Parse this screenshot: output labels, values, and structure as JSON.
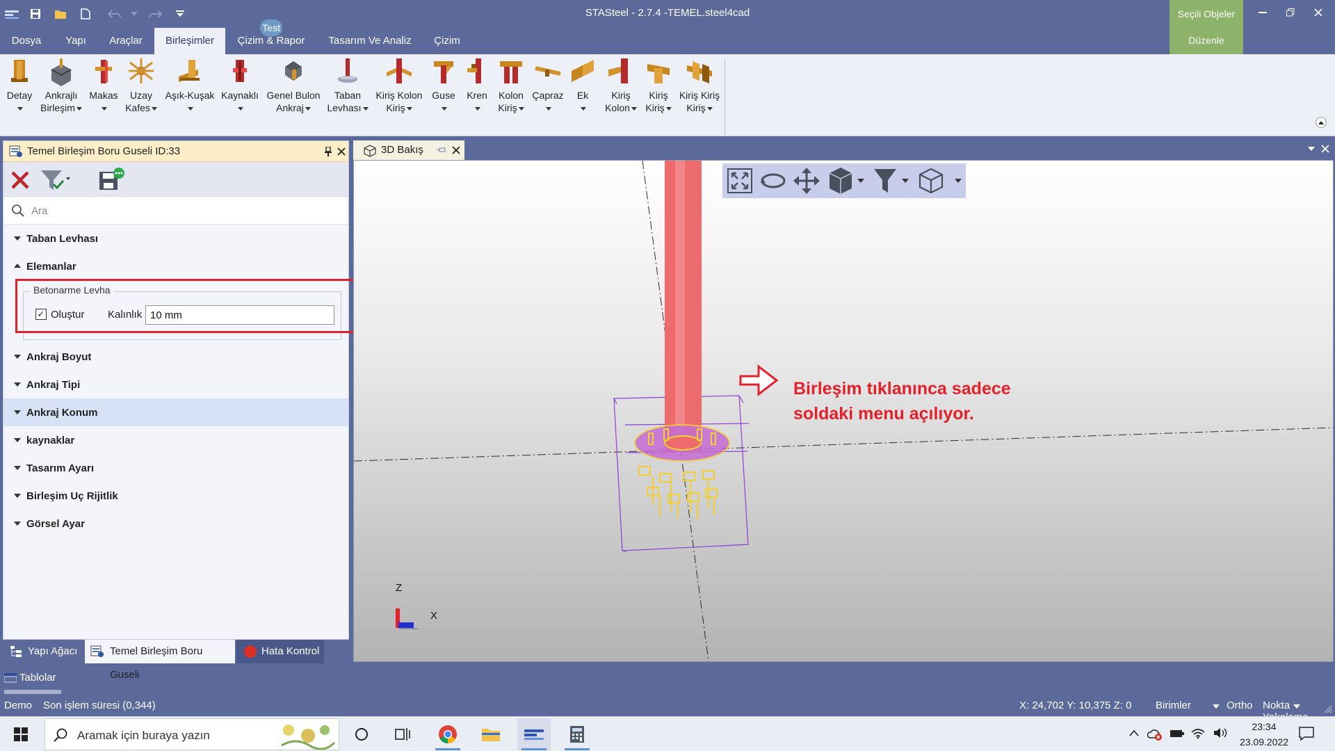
{
  "titlebar": {
    "app_title": "STASteel - 2.7.4 -TEMEL.steel4cad"
  },
  "menu": {
    "tabs": [
      "Dosya",
      "Yapı",
      "Araçlar",
      "Birleşimler",
      "Çizim & Rapor",
      "Tasarım Ve Analiz",
      "Çizim"
    ],
    "active": "Birleşimler",
    "test_badge": "Test"
  },
  "selected_objects": {
    "title": "Seçili Objeler",
    "edit": "Düzenle"
  },
  "ribbon": {
    "buttons": [
      {
        "l1": "Detay",
        "l2": "",
        "dd": true
      },
      {
        "l1": "Ankrajlı",
        "l2": "Birleşim",
        "dd": true
      },
      {
        "l1": "Makas",
        "l2": "",
        "dd": true
      },
      {
        "l1": "Uzay",
        "l2": "Kafes",
        "dd": true
      },
      {
        "l1": "Aşık-Kuşak",
        "l2": "",
        "dd": true
      },
      {
        "l1": "Kaynaklı",
        "l2": "",
        "dd": true
      },
      {
        "l1": "Genel Bulon",
        "l2": "Ankraj",
        "dd": true
      },
      {
        "l1": "Taban",
        "l2": "Levhası",
        "dd": true
      },
      {
        "l1": "Kiriş Kolon",
        "l2": "Kiriş",
        "dd": true
      },
      {
        "l1": "Guse",
        "l2": "",
        "dd": true
      },
      {
        "l1": "Kren",
        "l2": "",
        "dd": true
      },
      {
        "l1": "Kolon",
        "l2": "Kiriş",
        "dd": true
      },
      {
        "l1": "Çapraz",
        "l2": "",
        "dd": true
      },
      {
        "l1": "Ek",
        "l2": "",
        "dd": true
      },
      {
        "l1": "Kiriş",
        "l2": "Kolon",
        "dd": true
      },
      {
        "l1": "Kiriş",
        "l2": "Kiriş",
        "dd": true
      },
      {
        "l1": "Kiriş Kiriş",
        "l2": "Kiriş",
        "dd": true
      }
    ]
  },
  "left_panel": {
    "title": "Temel Birleşim Boru Guseli ID:33",
    "search_placeholder": "Ara",
    "sections": [
      {
        "label": "Taban Levhası",
        "expanded": false
      },
      {
        "label": "Elemanlar",
        "expanded": true
      },
      {
        "label": "Ankraj Boyut",
        "expanded": false
      },
      {
        "label": "Ankraj Tipi",
        "expanded": false
      },
      {
        "label": "Ankraj Konum",
        "expanded": false,
        "highlighted": true
      },
      {
        "label": "kaynaklar",
        "expanded": false
      },
      {
        "label": "Tasarım Ayarı",
        "expanded": false
      },
      {
        "label": "Birleşim Uç Rijitlik",
        "expanded": false
      },
      {
        "label": "Görsel Ayar",
        "expanded": false
      }
    ],
    "group": {
      "title": "Betonarme Levha",
      "checkbox_label": "Oluştur",
      "checked": true,
      "thickness_label": "Kalınlık",
      "thickness_value": "10 mm"
    },
    "bottom_tabs": [
      "Yapı Ağacı",
      "Temel Birleşim Boru Guseli",
      "Hata Kontrol"
    ]
  },
  "tablolar": "Tablolar",
  "view": {
    "tab_title": "3D Bakış",
    "annotation_line1": "Birleşim tıklanınca sadece",
    "annotation_line2": "soldaki menu açılıyor.",
    "axis_z": "Z",
    "axis_x": "X"
  },
  "status": {
    "mode": "Demo",
    "last_op": "Son işlem süresi (0,344)",
    "coords": "X: 24,702 Y: 10,375 Z: 0",
    "units": "Birimler",
    "ortho": "Ortho",
    "snap": "Nokta Yakalama"
  },
  "taskbar": {
    "search_placeholder": "Aramak için buraya yazın",
    "time": "23:34",
    "date": "23.09.2022"
  },
  "colors": {
    "chrome": "#5c6a9b",
    "ribbon": "#eef0f7",
    "accent_red": "#e4202b",
    "selected_green": "#8db36a"
  }
}
